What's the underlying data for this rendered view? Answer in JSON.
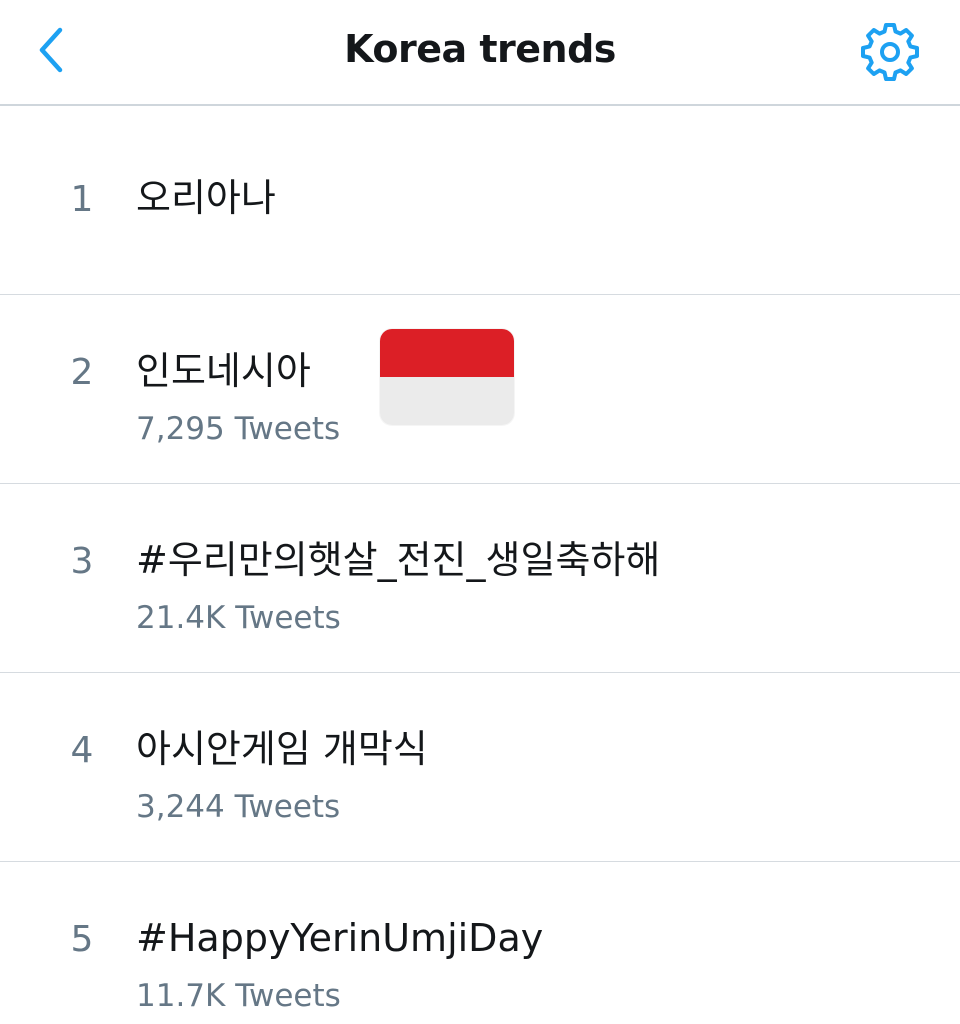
{
  "header": {
    "title": "Korea trends",
    "back_icon": "chevron-left-icon",
    "settings_icon": "gear-icon",
    "accent_color": "#1da1f2"
  },
  "trends": [
    {
      "rank": "1",
      "name": "오리아나",
      "count": ""
    },
    {
      "rank": "2",
      "name": "인도네시아",
      "count": "7,295 Tweets",
      "flag": {
        "icon": "indonesia-flag-icon",
        "top_color": "#dc1f26",
        "bottom_color": "#ebebeb"
      }
    },
    {
      "rank": "3",
      "name": "#우리만의햇살_전진_생일축하해",
      "count": "21.4K Tweets"
    },
    {
      "rank": "4",
      "name": "아시안게임 개막식",
      "count": "3,244 Tweets"
    },
    {
      "rank": "5",
      "name": "#HappyYerinUmjiDay",
      "count": "11.7K Tweets"
    }
  ]
}
